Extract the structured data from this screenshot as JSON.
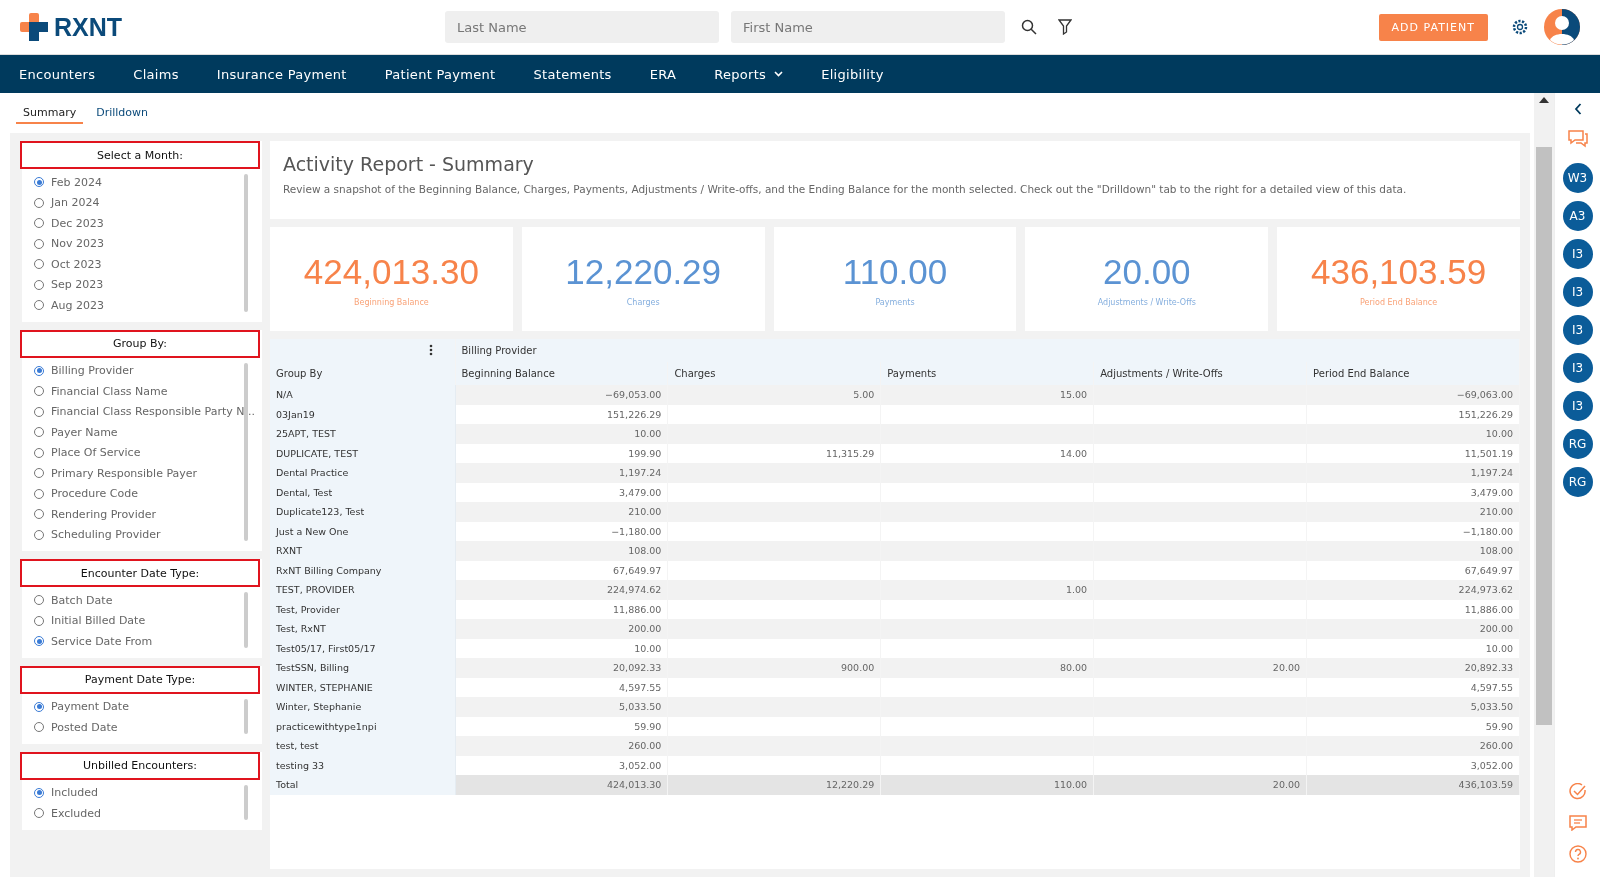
{
  "header": {
    "logo": "RXNT",
    "search_fields": [
      {
        "placeholder": "Last Name"
      },
      {
        "placeholder": "First Name"
      }
    ],
    "add_button": "ADD PATIENT"
  },
  "nav": [
    {
      "label": "Encounters",
      "dropdown": false
    },
    {
      "label": "Claims",
      "dropdown": false
    },
    {
      "label": "Insurance Payment",
      "dropdown": false
    },
    {
      "label": "Patient Payment",
      "dropdown": false
    },
    {
      "label": "Statements",
      "dropdown": false
    },
    {
      "label": "ERA",
      "dropdown": false
    },
    {
      "label": "Reports",
      "dropdown": true
    },
    {
      "label": "Eligibility",
      "dropdown": false
    }
  ],
  "tabs": [
    {
      "label": "Summary",
      "selected": true
    },
    {
      "label": "Drilldown",
      "selected": false
    }
  ],
  "filters": [
    {
      "title": "Select a Month:",
      "options": [
        {
          "label": "Feb 2024",
          "selected": true
        },
        {
          "label": "Jan 2024",
          "selected": false
        },
        {
          "label": "Dec 2023",
          "selected": false
        },
        {
          "label": "Nov 2023",
          "selected": false
        },
        {
          "label": "Oct 2023",
          "selected": false
        },
        {
          "label": "Sep 2023",
          "selected": false
        },
        {
          "label": "Aug 2023",
          "selected": false
        }
      ]
    },
    {
      "title": "Group By:",
      "options": [
        {
          "label": "Billing Provider",
          "selected": true
        },
        {
          "label": "Financial Class Name",
          "selected": false
        },
        {
          "label": "Financial Class Responsible Party N...",
          "selected": false
        },
        {
          "label": "Payer Name",
          "selected": false
        },
        {
          "label": "Place Of Service",
          "selected": false
        },
        {
          "label": "Primary Responsible Payer",
          "selected": false
        },
        {
          "label": "Procedure Code",
          "selected": false
        },
        {
          "label": "Rendering Provider",
          "selected": false
        },
        {
          "label": "Scheduling Provider",
          "selected": false
        }
      ]
    },
    {
      "title": "Encounter Date Type:",
      "options": [
        {
          "label": "Batch Date",
          "selected": false
        },
        {
          "label": "Initial Billed Date",
          "selected": false
        },
        {
          "label": "Service Date From",
          "selected": true
        }
      ]
    },
    {
      "title": "Payment Date Type:",
      "options": [
        {
          "label": "Payment Date",
          "selected": true
        },
        {
          "label": "Posted Date",
          "selected": false
        }
      ]
    },
    {
      "title": "Unbilled Encounters:",
      "options": [
        {
          "label": "Included",
          "selected": true
        },
        {
          "label": "Excluded",
          "selected": false
        }
      ]
    }
  ],
  "summary": {
    "title": "Activity Report - Summary",
    "description": "Review a snapshot of the Beginning Balance, Charges, Payments, Adjustments / Write-offs, and the Ending Balance for the month selected. Check out the \"Drilldown\" tab to the right for a detailed view of this data."
  },
  "stats": [
    {
      "value": "424,013.30",
      "label": "Beginning Balance",
      "color": "#f7834a"
    },
    {
      "value": "12,220.29",
      "label": "Charges",
      "color": "#5b93d3"
    },
    {
      "value": "110.00",
      "label": "Payments",
      "color": "#5b93d3"
    },
    {
      "value": "20.00",
      "label": "Adjustments / Write-Offs",
      "color": "#5b93d3"
    },
    {
      "value": "436,103.59",
      "label": "Period End Balance",
      "color": "#f7834a"
    }
  ],
  "table": {
    "pivot_label": "Billing Provider",
    "columns": [
      "Group By",
      "Beginning Balance",
      "Charges",
      "Payments",
      "Adjustments / Write-Offs",
      "Period End Balance"
    ],
    "rows": [
      [
        "N/A",
        "−69,053.00",
        "5.00",
        "15.00",
        null,
        "−69,063.00"
      ],
      [
        "03Jan19",
        "151,226.29",
        null,
        null,
        null,
        "151,226.29"
      ],
      [
        "25APT, TEST",
        "10.00",
        null,
        null,
        null,
        "10.00"
      ],
      [
        "DUPLICATE, TEST",
        "199.90",
        "11,315.29",
        "14.00",
        null,
        "11,501.19"
      ],
      [
        "Dental Practice",
        "1,197.24",
        null,
        null,
        null,
        "1,197.24"
      ],
      [
        "Dental, Test",
        "3,479.00",
        null,
        null,
        null,
        "3,479.00"
      ],
      [
        "Duplicate123, Test",
        "210.00",
        null,
        null,
        null,
        "210.00"
      ],
      [
        "Just a New One",
        "−1,180.00",
        null,
        null,
        null,
        "−1,180.00"
      ],
      [
        "RXNT",
        "108.00",
        null,
        null,
        null,
        "108.00"
      ],
      [
        "RxNT Billing Company",
        "67,649.97",
        null,
        null,
        null,
        "67,649.97"
      ],
      [
        "TEST, PROVIDER",
        "224,974.62",
        null,
        "1.00",
        null,
        "224,973.62"
      ],
      [
        "Test, Provider",
        "11,886.00",
        null,
        null,
        null,
        "11,886.00"
      ],
      [
        "Test, RxNT",
        "200.00",
        null,
        null,
        null,
        "200.00"
      ],
      [
        "Test05/17, First05/17",
        "10.00",
        null,
        null,
        null,
        "10.00"
      ],
      [
        "TestSSN, Billing",
        "20,092.33",
        "900.00",
        "80.00",
        "20.00",
        "20,892.33"
      ],
      [
        "WINTER, STEPHANIE",
        "4,597.55",
        null,
        null,
        null,
        "4,597.55"
      ],
      [
        "Winter, Stephanie",
        "5,033.50",
        null,
        null,
        null,
        "5,033.50"
      ],
      [
        "practicewithtype1npi",
        "59.90",
        null,
        null,
        null,
        "59.90"
      ],
      [
        "test, test",
        "260.00",
        null,
        null,
        null,
        "260.00"
      ],
      [
        "testing 33",
        "3,052.00",
        null,
        null,
        null,
        "3,052.00"
      ]
    ],
    "total": [
      "Total",
      "424,013.30",
      "12,220.29",
      "110.00",
      "20.00",
      "436,103.59"
    ]
  },
  "rail_avatars": [
    "W3",
    "A3",
    "I3",
    "I3",
    "I3",
    "I3",
    "I3",
    "RG",
    "RG"
  ]
}
